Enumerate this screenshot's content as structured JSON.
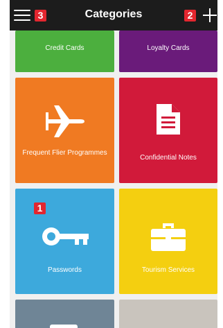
{
  "header": {
    "title": "Categories",
    "menu_badge": "3",
    "add_badge": "2"
  },
  "tiles": [
    {
      "label": "Credit Cards",
      "color": "#4caf3e",
      "icon": "credit-card-icon"
    },
    {
      "label": "Loyalty Cards",
      "color": "#6a1b7a",
      "icon": "loyalty-card-icon"
    },
    {
      "label": "Frequent Flier Programmes",
      "color": "#f07a22",
      "icon": "airplane-icon"
    },
    {
      "label": "Confidential Notes",
      "color": "#d11a3a",
      "icon": "document-icon"
    },
    {
      "label": "Passwords",
      "color": "#3da9dc",
      "icon": "key-icon",
      "badge": "1"
    },
    {
      "label": "Tourism Services",
      "color": "#f4cf10",
      "icon": "briefcase-icon"
    },
    {
      "label": "",
      "color": "#6f8596",
      "icon": ""
    },
    {
      "label": "",
      "color": "#c9c4bd",
      "icon": ""
    }
  ]
}
